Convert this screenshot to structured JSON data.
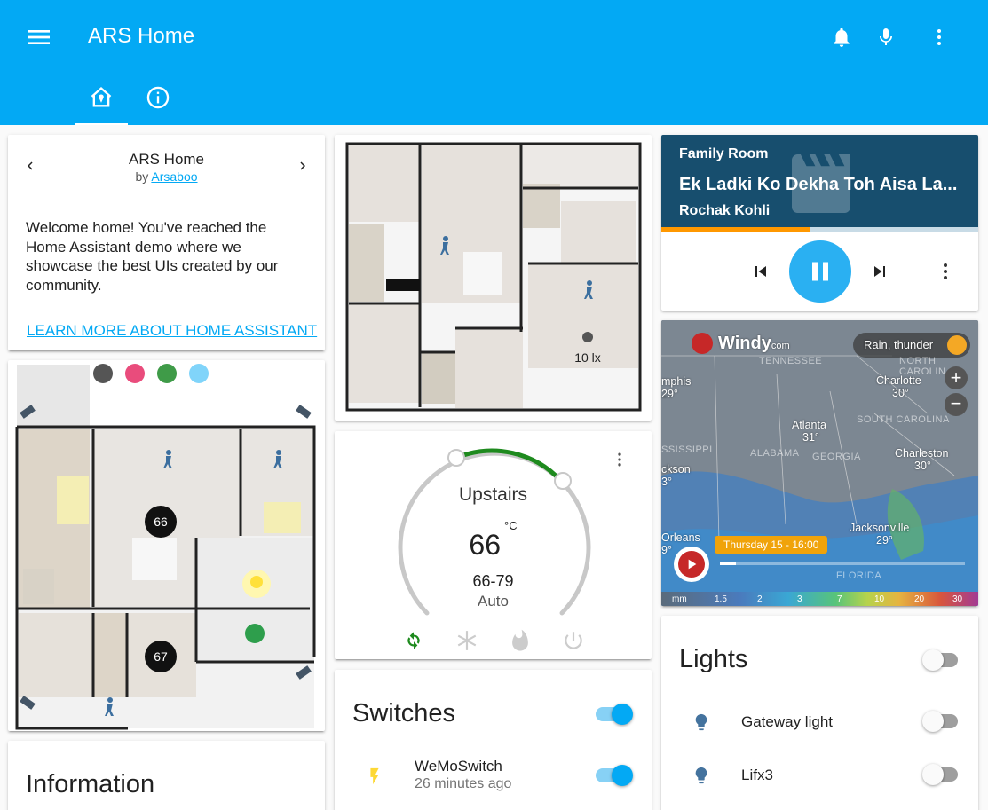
{
  "header": {
    "title": "ARS Home"
  },
  "welcome": {
    "title": "ARS Home",
    "by_prefix": "by",
    "author": "Arsaboo",
    "message": "Welcome home! You've reached the Home Assistant demo where we showcase the best UIs created by our community.",
    "learn_more": "LEARN MORE ABOUT HOME ASSISTANT"
  },
  "floorplan_main": {
    "thermostat_1": "66",
    "thermostat_2": "67"
  },
  "floorplan_up": {
    "lux": "10 lx"
  },
  "thermostat": {
    "name": "Upstairs",
    "current": "66",
    "unit": "°C",
    "range": "66-79",
    "mode": "Auto"
  },
  "switches": {
    "title": "Switches",
    "items": [
      {
        "name": "WeMoSwitch",
        "last_changed": "26 minutes ago",
        "state": "on"
      }
    ]
  },
  "media": {
    "room": "Family Room",
    "title": "Ek Ladki Ko Dekha Toh Aisa La...",
    "artist": "Rochak Kohli",
    "progress": 0.47
  },
  "windy": {
    "brand": "Windy",
    "brand_suffix": "com",
    "layer": "Rain, thunder",
    "timestamp": "Thursday 15 - 16:00",
    "cities": [
      {
        "name": "Charlotte",
        "temp": "30°"
      },
      {
        "name": "Atlanta",
        "temp": "31°"
      },
      {
        "name": "Charleston",
        "temp": "30°"
      },
      {
        "name": "Jacksonville",
        "temp": "29°"
      },
      {
        "name": "mphis",
        "temp": "29°"
      },
      {
        "name": "ckson",
        "temp": "3°"
      },
      {
        "name": "Orleans",
        "temp": "9°"
      }
    ],
    "states": [
      "TENNESSEE",
      "NORTH CAROLIN",
      "SOUTH CAROLINA",
      "ALABAMA",
      "GEORGIA",
      "SSISSIPPI",
      "FLORIDA"
    ],
    "legend": [
      "mm",
      "1.5",
      "2",
      "3",
      "7",
      "10",
      "20",
      "30"
    ]
  },
  "lights": {
    "title": "Lights",
    "items": [
      {
        "name": "Gateway light",
        "state": "off"
      },
      {
        "name": "Lifx3",
        "state": "off"
      }
    ]
  },
  "info": {
    "title": "Information"
  },
  "colors": {
    "primary": "#03a9f4",
    "media_bg": "#174e6e",
    "progress": "#ff9800",
    "heat_arc": "#2e7d32"
  }
}
